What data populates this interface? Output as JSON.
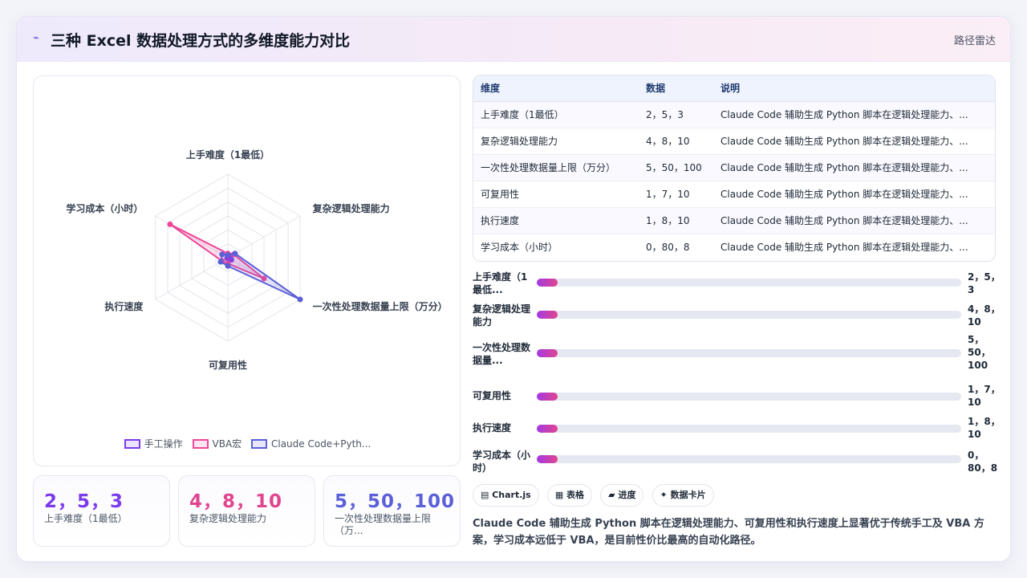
{
  "header": {
    "title": "三种 Excel 数据处理方式的多维度能力对比",
    "tag": "路径雷达",
    "icon": "line-chart-icon"
  },
  "colors": {
    "manual": "#7c3aed",
    "vba": "#ec4899",
    "claude": "#5b5fd8",
    "bar_gradient_start": "#a33ae2",
    "bar_gradient_end": "#e0458f"
  },
  "chart_data": {
    "type": "radar",
    "axes": [
      "上手难度（1最低）",
      "复杂逻辑处理能力",
      "一次性处理数据量上限（万分）",
      "可复用性",
      "执行速度",
      "学习成本（小时）"
    ],
    "rmax": 100,
    "grid_levels": 6,
    "series": [
      {
        "name": "手工操作",
        "values": [
          2,
          4,
          5,
          1,
          1,
          0
        ]
      },
      {
        "name": "VBA宏",
        "values": [
          5,
          8,
          50,
          7,
          8,
          80
        ]
      },
      {
        "name": "Claude Code+Pyth...",
        "values": [
          3,
          10,
          100,
          10,
          10,
          8
        ]
      }
    ],
    "legend_position": "bottom"
  },
  "stats": [
    {
      "value": "2，5，3",
      "label": "上手难度（1最低）"
    },
    {
      "value": "4，8，10",
      "label": "复杂逻辑处理能力"
    },
    {
      "value": "5，50，100",
      "label": "一次性处理数据量上限（万..."
    }
  ],
  "table": {
    "headers": [
      "维度",
      "数据",
      "说明"
    ],
    "rows": [
      [
        "上手难度（1最低）",
        "2，5，3",
        "Claude Code 辅助生成 Python 脚本在逻辑处理能力、..."
      ],
      [
        "复杂逻辑处理能力",
        "4，8，10",
        "Claude Code 辅助生成 Python 脚本在逻辑处理能力、..."
      ],
      [
        "一次性处理数据量上限（万分）",
        "5，50，100",
        "Claude Code 辅助生成 Python 脚本在逻辑处理能力、..."
      ],
      [
        "可复用性",
        "1，7，10",
        "Claude Code 辅助生成 Python 脚本在逻辑处理能力、..."
      ],
      [
        "执行速度",
        "1，8，10",
        "Claude Code 辅助生成 Python 脚本在逻辑处理能力、..."
      ],
      [
        "学习成本（小时）",
        "0，80，8",
        "Claude Code 辅助生成 Python 脚本在逻辑处理能力、..."
      ]
    ]
  },
  "bars": [
    {
      "label": "上手难度（1最低...",
      "value": "2，5，3",
      "fill": 0.05
    },
    {
      "label": "复杂逻辑处理能力",
      "value": "4，8，10",
      "fill": 0.05
    },
    {
      "label": "一次性处理数据量...",
      "value": "5，50，100",
      "fill": 0.05
    },
    {
      "label": "可复用性",
      "value": "1，7，10",
      "fill": 0.05
    },
    {
      "label": "执行速度",
      "value": "1，8，10",
      "fill": 0.05
    },
    {
      "label": "学习成本（小时）",
      "value": "0，80，8",
      "fill": 0.05
    }
  ],
  "chips": [
    "▤ Chart.js",
    "▦ 表格",
    "▰ 进度",
    "✦ 数据卡片"
  ],
  "summary": "Claude Code 辅助生成 Python 脚本在逻辑处理能力、可复用性和执行速度上显著优于传统手工及 VBA 方案，学习成本远低于 VBA，是目前性价比最高的自动化路径。"
}
